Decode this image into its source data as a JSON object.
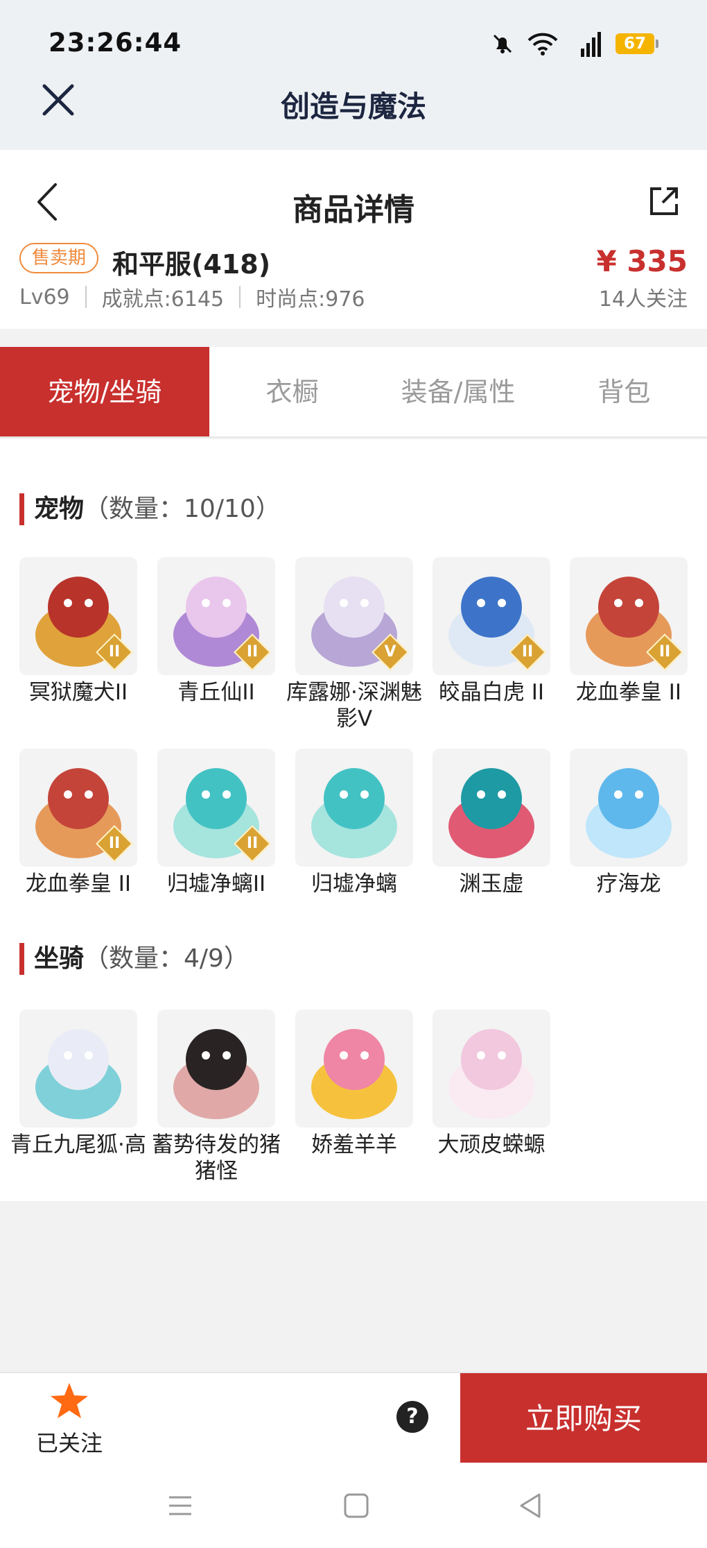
{
  "status": {
    "time": "23:26:44",
    "battery": "67",
    "network": "5G"
  },
  "app": {
    "title": "创造与魔法"
  },
  "page": {
    "title": "商品详情"
  },
  "product": {
    "badge": "售卖期",
    "server": "和平服(418)",
    "price": "¥ 335",
    "level": "Lv69",
    "achievement": "成就点:6145",
    "fashion": "时尚点:976",
    "followers": "14人关注"
  },
  "tabs": [
    {
      "label": "宠物/坐骑",
      "active": true
    },
    {
      "label": "衣橱"
    },
    {
      "label": "装备/属性"
    },
    {
      "label": "背包"
    }
  ],
  "pets": {
    "title": "宠物",
    "count": "（数量：10/10）",
    "items": [
      {
        "name": "冥狱魔犬II",
        "grade": "II",
        "color": "#b8332a",
        "color2": "#e0a23a"
      },
      {
        "name": "青丘仙II",
        "grade": "II",
        "color": "#e9c6ec",
        "color2": "#b089d6"
      },
      {
        "name": "库露娜·深渊魅影V",
        "grade": "V",
        "color": "#e6e0f2",
        "color2": "#b7a6d6"
      },
      {
        "name": "皎晶白虎 II",
        "grade": "II",
        "color": "#3d74c9",
        "color2": "#dfe9f5"
      },
      {
        "name": "龙血拳皇 II",
        "grade": "II",
        "color": "#c4443a",
        "color2": "#e69a5a"
      },
      {
        "name": "龙血拳皇 II",
        "grade": "II",
        "color": "#c4443a",
        "color2": "#e69a5a"
      },
      {
        "name": "归墟净螭II",
        "grade": "II",
        "color": "#43c2c4",
        "color2": "#a6e4de"
      },
      {
        "name": "归墟净螭",
        "grade": "",
        "color": "#43c2c4",
        "color2": "#a6e4de"
      },
      {
        "name": "渊玉虚",
        "grade": "",
        "color": "#1e9aa4",
        "color2": "#e05a73"
      },
      {
        "name": "疗海龙",
        "grade": "",
        "color": "#5fb8ec",
        "color2": "#bfe6fa"
      }
    ]
  },
  "mounts": {
    "title": "坐骑",
    "count": "（数量：4/9）",
    "items": [
      {
        "name": "青丘九尾狐·高",
        "color": "#e9ecf6",
        "color2": "#7fd0d9"
      },
      {
        "name": "蓄势待发的猪猪怪",
        "color": "#2a2323",
        "color2": "#e1a8a8"
      },
      {
        "name": "娇羞羊羊",
        "color": "#ef86a5",
        "color2": "#f6c23e"
      },
      {
        "name": "大顽皮蝾螈",
        "color": "#f1c8de",
        "color2": "#faeaf2"
      }
    ]
  },
  "bottom": {
    "follow_label": "已关注",
    "help_label": "?",
    "buy_label": "立即购买"
  },
  "colors": {
    "accent": "#c8302e",
    "badge": "#f08a3c",
    "star": "#ff6a13"
  }
}
